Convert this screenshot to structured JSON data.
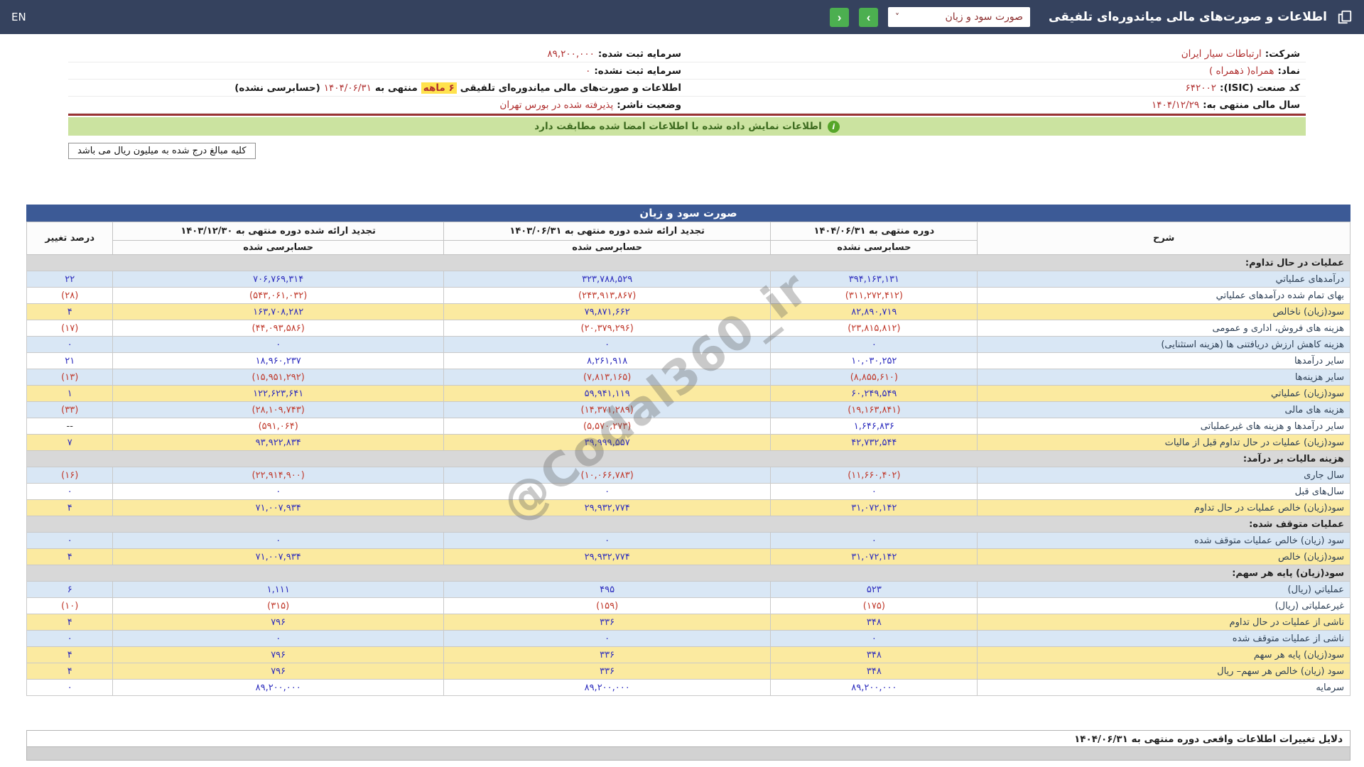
{
  "topbar": {
    "en_label": "EN",
    "title": "اطلاعات و صورت‌های مالی میاندوره‌ای تلفیقی",
    "statement_select": "صورت سود و زیان",
    "select_caret": "˅",
    "next_label": "›",
    "prev_label": "‹"
  },
  "company": {
    "company_label": "شرکت:",
    "company_value": "ارتباطات سیار ایران",
    "symbol_label": "نماد:",
    "symbol_value": "همراه( ذهمراه )",
    "isic_label": "کد صنعت (ISIC):",
    "isic_value": "۶۴۲۰۰۲",
    "fiscal_year_label": "سال مالی منتهی به:",
    "fiscal_year_value": "۱۴۰۴/۱۲/۲۹",
    "registered_capital_label": "سرمایه ثبت شده:",
    "registered_capital_value": "۸۹,۲۰۰,۰۰۰",
    "unregistered_capital_label": "سرمایه ثبت نشده:",
    "unregistered_capital_value": "۰",
    "report_label": "اطلاعات و صورت‌های مالی میاندوره‌ای تلفیقی",
    "report_period_highlight": "۶ ماهه",
    "report_mid": "منتهی به",
    "report_date": "۱۴۰۴/۰۶/۳۱",
    "report_suffix": "(حسابرسی نشده)",
    "status_label": "وضعیت ناشر:",
    "status_value": "پذیرفته شده در بورس تهران"
  },
  "banner": {
    "text": "اطلاعات نمایش داده شده با اطلاعات امضا شده مطابقت دارد",
    "icon_glyph": "i"
  },
  "note": {
    "text": "کلیه مبالغ درج شده به میلیون ریال می باشد"
  },
  "statement": {
    "title": "صورت سود و زیان",
    "columns": {
      "desc": "شرح",
      "period1": "دوره منتهی به ۱۴۰۴/۰۶/۳۱",
      "period1_sub": "حسابرسی نشده",
      "period2": "تجدید ارائه شده دوره منتهی به ۱۴۰۳/۰۶/۳۱",
      "period2_sub": "حسابرسی شده",
      "period3": "تجدید ارائه شده دوره منتهی به ۱۴۰۳/۱۲/۳۰",
      "period3_sub": "حسابرسی شده",
      "change": "درصد تغییر"
    },
    "rows": [
      {
        "type": "section",
        "label": "عملیات در حال تداوم:"
      },
      {
        "type": "data",
        "style": "blue",
        "label": "درآمدهای عملیاتي",
        "v1": "۳۹۴,۱۶۳,۱۳۱",
        "v2": "۳۲۳,۷۸۸,۵۲۹",
        "v3": "۷۰۶,۷۶۹,۳۱۴",
        "chg": "۲۲"
      },
      {
        "type": "data",
        "style": "white",
        "label": "بهای تمام شده درآمدهای عملیاتي",
        "v1": "(۳۱۱,۲۷۲,۴۱۲)",
        "v2": "(۲۴۳,۹۱۳,۸۶۷)",
        "v3": "(۵۴۳,۰۶۱,۰۳۲)",
        "chg": "(۲۸)"
      },
      {
        "type": "data",
        "style": "yellow",
        "label": "سود(زیان) ناخالص",
        "v1": "۸۲,۸۹۰,۷۱۹",
        "v2": "۷۹,۸۷۱,۶۶۲",
        "v3": "۱۶۳,۷۰۸,۲۸۲",
        "chg": "۴"
      },
      {
        "type": "data",
        "style": "white",
        "label": "هزینه های فروش، اداری و عمومی",
        "v1": "(۲۳,۸۱۵,۸۱۲)",
        "v2": "(۲۰,۳۷۹,۲۹۶)",
        "v3": "(۴۴,۰۹۳,۵۸۶)",
        "chg": "(۱۷)"
      },
      {
        "type": "data",
        "style": "blue",
        "label": "هزینه کاهش ارزش دریافتنی ها (هزینه استثنایی)",
        "v1": "۰",
        "v2": "۰",
        "v3": "۰",
        "chg": "۰"
      },
      {
        "type": "data",
        "style": "white",
        "label": "سایر درآمدها",
        "v1": "۱۰,۰۳۰,۲۵۲",
        "v2": "۸,۲۶۱,۹۱۸",
        "v3": "۱۸,۹۶۰,۲۳۷",
        "chg": "۲۱"
      },
      {
        "type": "data",
        "style": "blue",
        "label": "سایر هزینه‌ها",
        "v1": "(۸,۸۵۵,۶۱۰)",
        "v2": "(۷,۸۱۳,۱۶۵)",
        "v3": "(۱۵,۹۵۱,۲۹۲)",
        "chg": "(۱۳)"
      },
      {
        "type": "data",
        "style": "yellow",
        "label": "سود(زیان) عملیاتي",
        "v1": "۶۰,۲۴۹,۵۴۹",
        "v2": "۵۹,۹۴۱,۱۱۹",
        "v3": "۱۲۲,۶۲۳,۶۴۱",
        "chg": "۱"
      },
      {
        "type": "data",
        "style": "blue",
        "label": "هزینه های مالی",
        "v1": "(۱۹,۱۶۳,۸۴۱)",
        "v2": "(۱۴,۳۷۱,۲۸۹)",
        "v3": "(۲۸,۱۰۹,۷۴۳)",
        "chg": "(۳۳)"
      },
      {
        "type": "data",
        "style": "white",
        "label": "سایر درآمدها و هزینه های غیرعملیاتی",
        "v1": "۱,۶۴۶,۸۳۶",
        "v2": "(۵,۵۷۰,۲۷۳)",
        "v3": "(۵۹۱,۰۶۴)",
        "chg": "--"
      },
      {
        "type": "data",
        "style": "yellow",
        "label": "سود(زیان) عملیات در حال تداوم قبل از مالیات",
        "v1": "۴۲,۷۳۲,۵۴۴",
        "v2": "۳۹,۹۹۹,۵۵۷",
        "v3": "۹۳,۹۲۲,۸۳۴",
        "chg": "۷"
      },
      {
        "type": "section",
        "label": "هزینه مالیات بر درآمد:"
      },
      {
        "type": "data",
        "style": "blue",
        "label": "سال جاری",
        "v1": "(۱۱,۶۶۰,۴۰۲)",
        "v2": "(۱۰,۰۶۶,۷۸۳)",
        "v3": "(۲۲,۹۱۴,۹۰۰)",
        "chg": "(۱۶)"
      },
      {
        "type": "data",
        "style": "white",
        "label": "سال‌های قبل",
        "v1": "۰",
        "v2": "۰",
        "v3": "۰",
        "chg": "۰"
      },
      {
        "type": "data",
        "style": "yellow",
        "label": "سود(زیان) خالص عملیات در حال تداوم",
        "v1": "۳۱,۰۷۲,۱۴۲",
        "v2": "۲۹,۹۳۲,۷۷۴",
        "v3": "۷۱,۰۰۷,۹۳۴",
        "chg": "۴"
      },
      {
        "type": "section",
        "label": "عملیات متوقف شده:"
      },
      {
        "type": "data",
        "style": "blue",
        "label": "سود (زیان) خالص عملیات متوقف شده",
        "v1": "۰",
        "v2": "۰",
        "v3": "۰",
        "chg": "۰"
      },
      {
        "type": "data",
        "style": "yellow",
        "label": "سود(زیان) خالص",
        "v1": "۳۱,۰۷۲,۱۴۲",
        "v2": "۲۹,۹۳۲,۷۷۴",
        "v3": "۷۱,۰۰۷,۹۳۴",
        "chg": "۴"
      },
      {
        "type": "section",
        "label": "سود(زیان) پایه هر سهم:"
      },
      {
        "type": "data",
        "style": "blue",
        "label": "عملیاتي (ریال)",
        "v1": "۵۲۳",
        "v2": "۴۹۵",
        "v3": "۱,۱۱۱",
        "chg": "۶"
      },
      {
        "type": "data",
        "style": "white",
        "label": "غیرعملیاتی (ریال)",
        "v1": "(۱۷۵)",
        "v2": "(۱۵۹)",
        "v3": "(۳۱۵)",
        "chg": "(۱۰)"
      },
      {
        "type": "data",
        "style": "yellow",
        "label": "ناشی از عملیات در حال تداوم",
        "v1": "۳۴۸",
        "v2": "۳۳۶",
        "v3": "۷۹۶",
        "chg": "۴"
      },
      {
        "type": "data",
        "style": "blue",
        "label": "ناشی از عملیات متوقف شده",
        "v1": "۰",
        "v2": "۰",
        "v3": "۰",
        "chg": "۰"
      },
      {
        "type": "data",
        "style": "yellow",
        "label": "سود(زیان) پایه هر سهم",
        "v1": "۳۴۸",
        "v2": "۳۳۶",
        "v3": "۷۹۶",
        "chg": "۴"
      },
      {
        "type": "data",
        "style": "yellow",
        "label": "سود (زیان) خالص هر سهم– ریال",
        "v1": "۳۴۸",
        "v2": "۳۳۶",
        "v3": "۷۹۶",
        "chg": "۴"
      },
      {
        "type": "data",
        "style": "white",
        "label": "سرمایه",
        "v1": "۸۹,۲۰۰,۰۰۰",
        "v2": "۸۹,۲۰۰,۰۰۰",
        "v3": "۸۹,۲۰۰,۰۰۰",
        "chg": "۰"
      }
    ]
  },
  "reasons": {
    "title": "دلایل تغییرات اطلاعات واقعی دوره منتهی به ۱۴۰۴/۰۶/۳۱"
  },
  "watermark": "@Codal360_ir",
  "colors": {
    "topbar": "#35425e",
    "table_title": "#3c5a96",
    "row_blue": "#d9e7f5",
    "row_yellow": "#fbeaa0",
    "section_gray": "#d8d8d8",
    "positive_number": "#2d2dbe",
    "negative_number": "#c0392b",
    "nav_green": "#4caf50",
    "banner_green": "#cbe3a0",
    "company_value_red": "#b03030",
    "divider_maroon": "#993333"
  }
}
